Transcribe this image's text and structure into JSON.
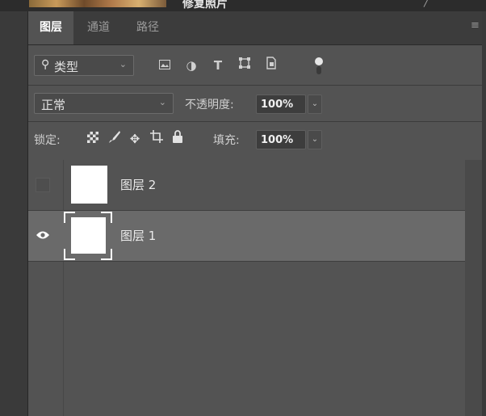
{
  "header": {
    "doc_title": "修复照片"
  },
  "tabs": [
    {
      "label": "图层",
      "active": true
    },
    {
      "label": "通道",
      "active": false
    },
    {
      "label": "路径",
      "active": false
    }
  ],
  "filter": {
    "kind_label": "类型",
    "icons": [
      "image-filter-icon",
      "adjustment-filter-icon",
      "type-filter-icon",
      "shape-filter-icon",
      "smart-object-filter-icon",
      "filter-toggle-icon"
    ]
  },
  "blend": {
    "mode": "正常",
    "opacity_label": "不透明度:",
    "opacity_value": "100%"
  },
  "lock": {
    "label": "锁定:",
    "fill_label": "填充:",
    "fill_value": "100%"
  },
  "layers": [
    {
      "name": "图层 2",
      "visible": false,
      "selected": false
    },
    {
      "name": "图层 1",
      "visible": true,
      "selected": true
    }
  ],
  "colors": {
    "panel": "#535353",
    "tabbar": "#3c3c3c",
    "selected_layer": "#6a6a6a"
  }
}
